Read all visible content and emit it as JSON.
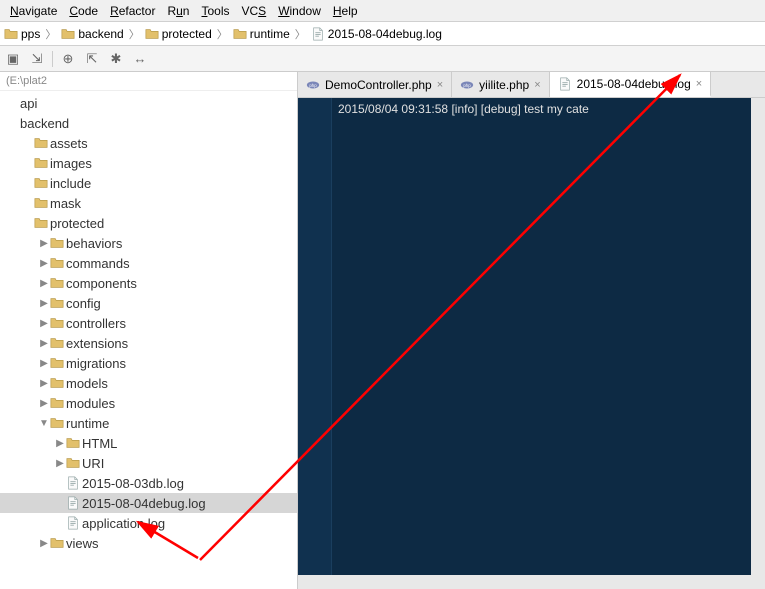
{
  "menu": {
    "items": [
      {
        "label": "Navigate",
        "ul": "N"
      },
      {
        "label": "Code",
        "ul": "C"
      },
      {
        "label": "Refactor",
        "ul": "R"
      },
      {
        "label": "Run",
        "ul": "u"
      },
      {
        "label": "Tools",
        "ul": "T"
      },
      {
        "label": "VCS",
        "ul": "S"
      },
      {
        "label": "Window",
        "ul": "W"
      },
      {
        "label": "Help",
        "ul": "H"
      }
    ]
  },
  "breadcrumb": {
    "segments": [
      {
        "label": "pps",
        "icon": "folder"
      },
      {
        "label": "backend",
        "icon": "folder"
      },
      {
        "label": "protected",
        "icon": "folder"
      },
      {
        "label": "runtime",
        "icon": "folder"
      },
      {
        "label": "2015-08-04debug.log",
        "icon": "file"
      }
    ]
  },
  "project_root": "(E:\\plat2",
  "tree": [
    {
      "type": "label",
      "depth": 0,
      "label": "api"
    },
    {
      "type": "label",
      "depth": 0,
      "label": "backend"
    },
    {
      "type": "folder",
      "depth": 1,
      "label": "assets",
      "expand": "none"
    },
    {
      "type": "folder",
      "depth": 1,
      "label": "images",
      "expand": "none"
    },
    {
      "type": "folder",
      "depth": 1,
      "label": "include",
      "expand": "none"
    },
    {
      "type": "folder",
      "depth": 1,
      "label": "mask",
      "expand": "none"
    },
    {
      "type": "folder",
      "depth": 1,
      "label": "protected",
      "expand": "none"
    },
    {
      "type": "folder",
      "depth": 2,
      "label": "behaviors",
      "expand": "closed"
    },
    {
      "type": "folder",
      "depth": 2,
      "label": "commands",
      "expand": "closed"
    },
    {
      "type": "folder",
      "depth": 2,
      "label": "components",
      "expand": "closed"
    },
    {
      "type": "folder",
      "depth": 2,
      "label": "config",
      "expand": "closed"
    },
    {
      "type": "folder",
      "depth": 2,
      "label": "controllers",
      "expand": "closed"
    },
    {
      "type": "folder",
      "depth": 2,
      "label": "extensions",
      "expand": "closed"
    },
    {
      "type": "folder",
      "depth": 2,
      "label": "migrations",
      "expand": "closed"
    },
    {
      "type": "folder",
      "depth": 2,
      "label": "models",
      "expand": "closed"
    },
    {
      "type": "folder",
      "depth": 2,
      "label": "modules",
      "expand": "closed"
    },
    {
      "type": "folder",
      "depth": 2,
      "label": "runtime",
      "expand": "open"
    },
    {
      "type": "folder",
      "depth": 3,
      "label": "HTML",
      "expand": "closed"
    },
    {
      "type": "folder",
      "depth": 3,
      "label": "URI",
      "expand": "closed"
    },
    {
      "type": "file",
      "depth": 3,
      "label": "2015-08-03db.log"
    },
    {
      "type": "file",
      "depth": 3,
      "label": "2015-08-04debug.log",
      "selected": true
    },
    {
      "type": "file",
      "depth": 3,
      "label": "application.log"
    },
    {
      "type": "folder",
      "depth": 2,
      "label": "views",
      "expand": "closed",
      "partial": true
    }
  ],
  "tabs": [
    {
      "label": "DemoController.php",
      "icon": "php",
      "active": false
    },
    {
      "label": "yiilite.php",
      "icon": "php",
      "active": false
    },
    {
      "label": "2015-08-04debug.log",
      "icon": "file",
      "active": true
    }
  ],
  "editor": {
    "line": "2015/08/04 09:31:58 [info] [debug] test my cate"
  }
}
